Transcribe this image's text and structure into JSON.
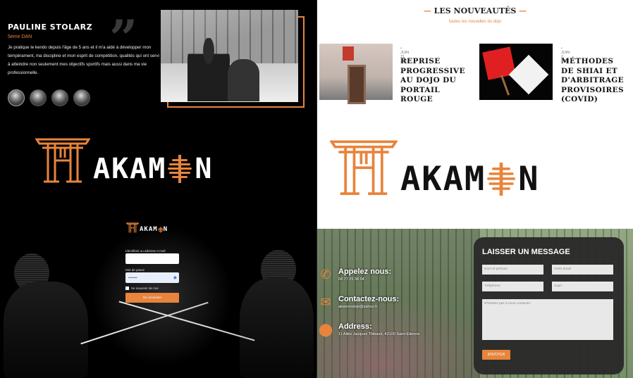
{
  "testimonial": {
    "name": "PAULINE STOLARZ",
    "rank": "5eme DAN",
    "quote": "Je pratique le kendo depuis l'âge de 5 ans et il m'a aidé à développer mon tempérament, ma discipline et mon esprit de compétition, qualités qui ont servi à atteindre non seulement mes objectifs sportifs mais aussi dans ma vie professionnelle.",
    "quote_icon": "quote-icon",
    "avatars": 4
  },
  "news": {
    "title": "LES NOUVEAUTÉS",
    "subtitle": "toutes les nouvelles du dojo",
    "articles": [
      {
        "date": "JUIN 21, 2021",
        "headline": "REPRISE PROGRESSIVE AU DOJO DU PORTAIL ROUGE"
      },
      {
        "date": "JUIN 2, 2021",
        "headline": "MÉTHODES DE SHIAI ET D'ARBITRAGE PROVISOIRES (COVID)"
      }
    ]
  },
  "logo": {
    "text": "AKAM",
    "text_end": "N",
    "accent": "#e8843c"
  },
  "login": {
    "logo_text": "AKAM",
    "logo_text_end": "N",
    "id_label": "Identifiant ou adresse e-mail",
    "password_label": "Mot de passe",
    "password_value": "••••••••",
    "remember_label": "Se souvenir de moi",
    "submit_label": "Se connecter"
  },
  "contact": {
    "items": [
      {
        "icon": "phone-icon",
        "title": "Appelez nous:",
        "value": "04 77 25 38 04"
      },
      {
        "icon": "mail-icon",
        "title": "Contactez-nous:",
        "value": "akamondojo@yahoo.fr"
      },
      {
        "icon": "location-icon",
        "title": "Address:",
        "value": "11 Allée Jacques Thibaud, 42100 Saint-Etienne"
      }
    ],
    "form": {
      "title": "LAISSER UN MESSAGE",
      "name_placeholder": "Nom et prénom",
      "email_placeholder": "Votre email",
      "phone_placeholder": "Téléphone",
      "subject_placeholder": "Sujet",
      "message_placeholder": "N'hésitez pas à nous contacter",
      "send_label": "ENVOYER"
    }
  },
  "colors": {
    "accent": "#e8843c",
    "dark": "#000000",
    "panel": "#2a2a2a"
  }
}
